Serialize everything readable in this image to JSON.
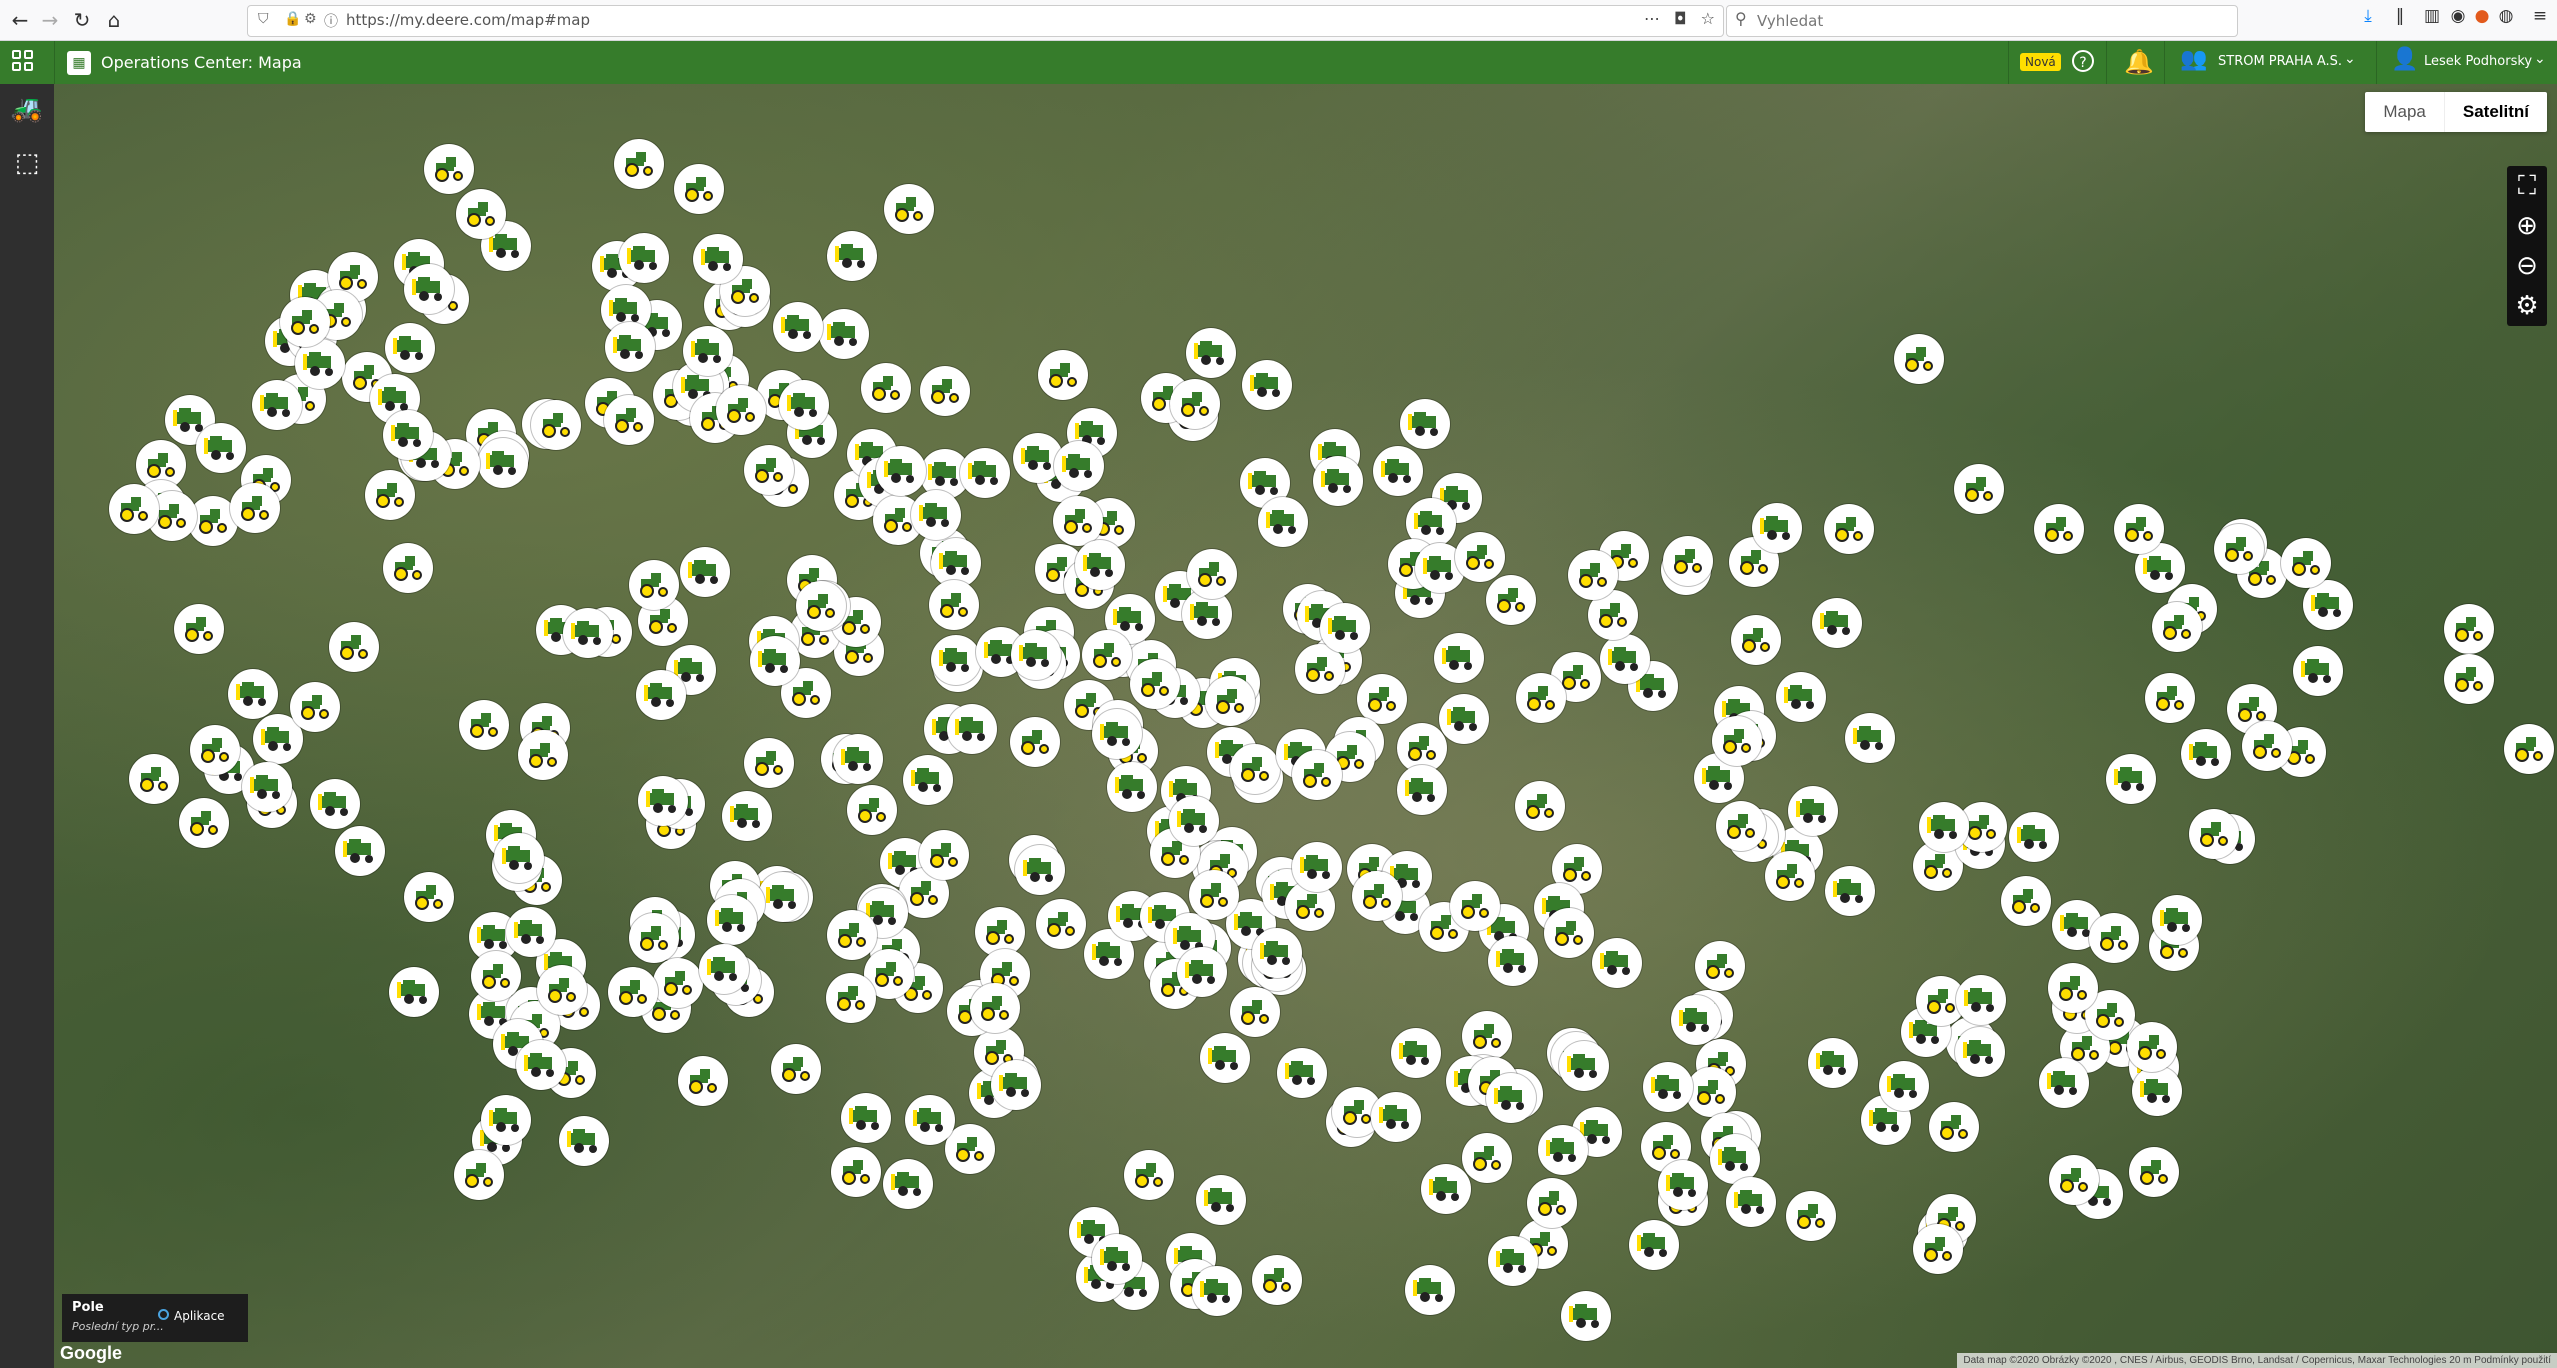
{
  "browser": {
    "url": "https://my.deere.com/map#map",
    "search_placeholder": "Vyhledat"
  },
  "appbar": {
    "title": "Operations Center: Mapa",
    "new_badge": "Nová",
    "org_name": "STROM PRAHA A.S.",
    "user_name": "Lesek Podhorsky"
  },
  "map": {
    "toggle_map": "Mapa",
    "toggle_satellite": "Satelitní",
    "legend_title": "Pole",
    "legend_subtitle": "Poslední typ pr...",
    "legend_option": "Aplikace",
    "google_label": "Google",
    "attribution": "Data map ©2020 Obrázky ©2020 , CNES / Airbus, GEODIS Brno, Landsat / Copernicus, Maxar Technologies   20 m   Podmínky použití"
  },
  "colors": {
    "appbar": "#367c2b",
    "tractor_green": "#367c2b",
    "tractor_yellow": "#ffde00"
  }
}
